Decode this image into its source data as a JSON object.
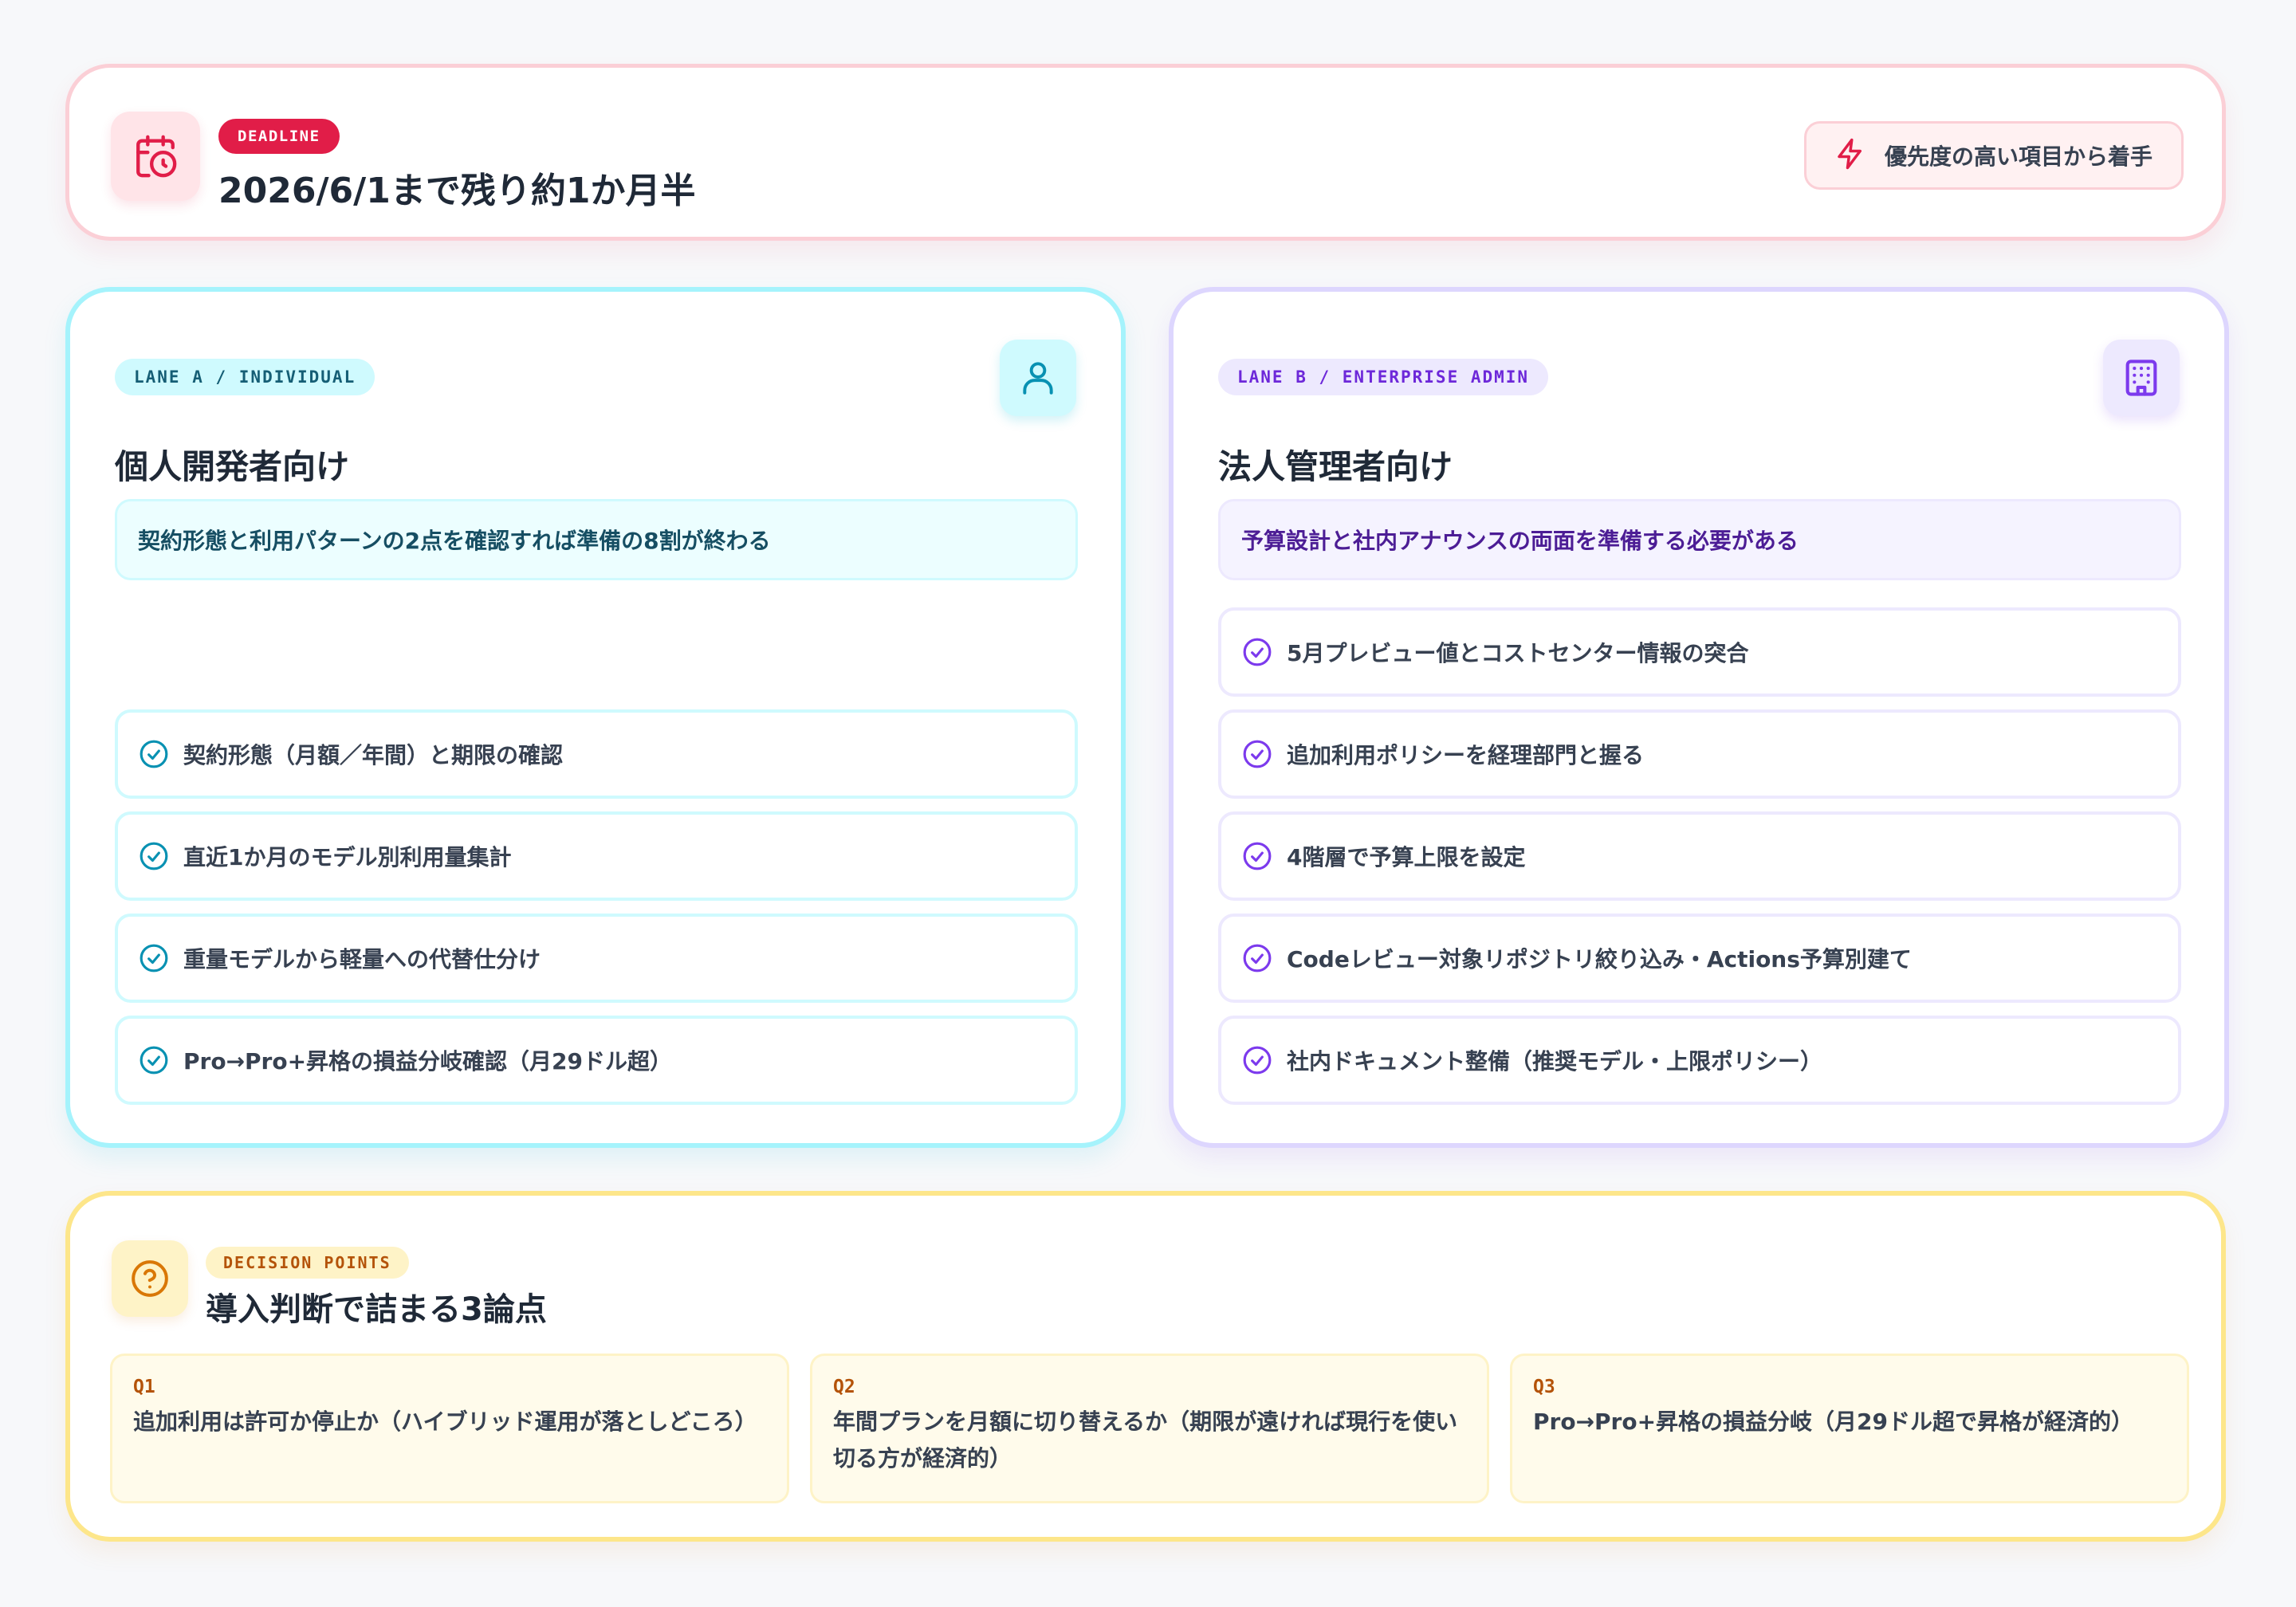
{
  "deadline": {
    "badge": "DEADLINE",
    "title": "2026/6/1まで残り約1か月半",
    "priority_label": "優先度の高い項目から着手",
    "icon": "calendar-clock-icon",
    "accent": "#e11d48"
  },
  "lane_a": {
    "tag": "LANE A / INDIVIDUAL",
    "title": "個人開発者向け",
    "summary": "契約形態と利用パターンの2点を確認すれば準備の8割が終わる",
    "icon": "user-icon",
    "accent": "#0891b2",
    "tasks": [
      "契約形態（月額／年間）と期限の確認",
      "直近1か月のモデル別利用量集計",
      "重量モデルから軽量への代替仕分け",
      "Pro→Pro+昇格の損益分岐確認（月29ドル超）"
    ]
  },
  "lane_b": {
    "tag": "LANE B / ENTERPRISE ADMIN",
    "title": "法人管理者向け",
    "summary": "予算設計と社内アナウンスの両面を準備する必要がある",
    "icon": "building-icon",
    "accent": "#7c3aed",
    "tasks": [
      "5月プレビュー値とコストセンター情報の突合",
      "追加利用ポリシーを経理部門と握る",
      "4階層で予算上限を設定",
      "Codeレビュー対象リポジトリ絞り込み・Actions予算別建て",
      "社内ドキュメント整備（推奨モデル・上限ポリシー）"
    ]
  },
  "decision": {
    "tag": "DECISION POINTS",
    "title": "導入判断で詰まる3論点",
    "icon": "question-circle-icon",
    "accent": "#d97706",
    "questions": [
      {
        "id": "Q1",
        "text": "追加利用は許可か停止か（ハイブリッド運用が落としどころ）"
      },
      {
        "id": "Q2",
        "text": "年間プランを月額に切り替えるか（期限が遠ければ現行を使い切る方が経済的）"
      },
      {
        "id": "Q3",
        "text": "Pro→Pro+昇格の損益分岐（月29ドル超で昇格が経済的）"
      }
    ]
  }
}
